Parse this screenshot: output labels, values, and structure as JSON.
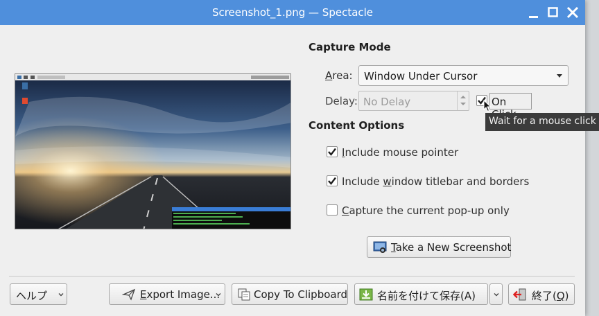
{
  "window": {
    "title": "Screenshot_1.png — Spectacle",
    "controls": [
      "minimize",
      "maximize",
      "close"
    ],
    "accent_color": "#4f8fdc"
  },
  "capture_mode": {
    "heading": "Capture Mode",
    "area_label_u": "A",
    "area_label_rest": "rea:",
    "area_value": "Window Under Cursor",
    "delay_label": "Delay:",
    "delay_value": "No Delay",
    "on_click_label": "On Click",
    "on_click_checked": true,
    "tooltip": "Wait for a mouse click"
  },
  "content_options": {
    "heading": "Content Options",
    "include_pointer_u": "I",
    "include_pointer_rest": "nclude mouse pointer",
    "include_pointer_checked": true,
    "include_titlebar_a": "Include ",
    "include_titlebar_u": "w",
    "include_titlebar_b": "indow titlebar and borders",
    "include_titlebar_checked": true,
    "capture_popup_u": "C",
    "capture_popup_rest": "apture the current pop-up only",
    "capture_popup_checked": false
  },
  "take_screenshot": {
    "u": "T",
    "rest": "ake a New Screenshot"
  },
  "footer": {
    "help": "ヘルプ",
    "export_u": "E",
    "export_rest": "xport Image...",
    "copy": "Copy To Clipboard",
    "save_as": "名前を付けて保存(A)",
    "quit_a": "終了(",
    "quit_u": "Q",
    "quit_b": ")"
  }
}
